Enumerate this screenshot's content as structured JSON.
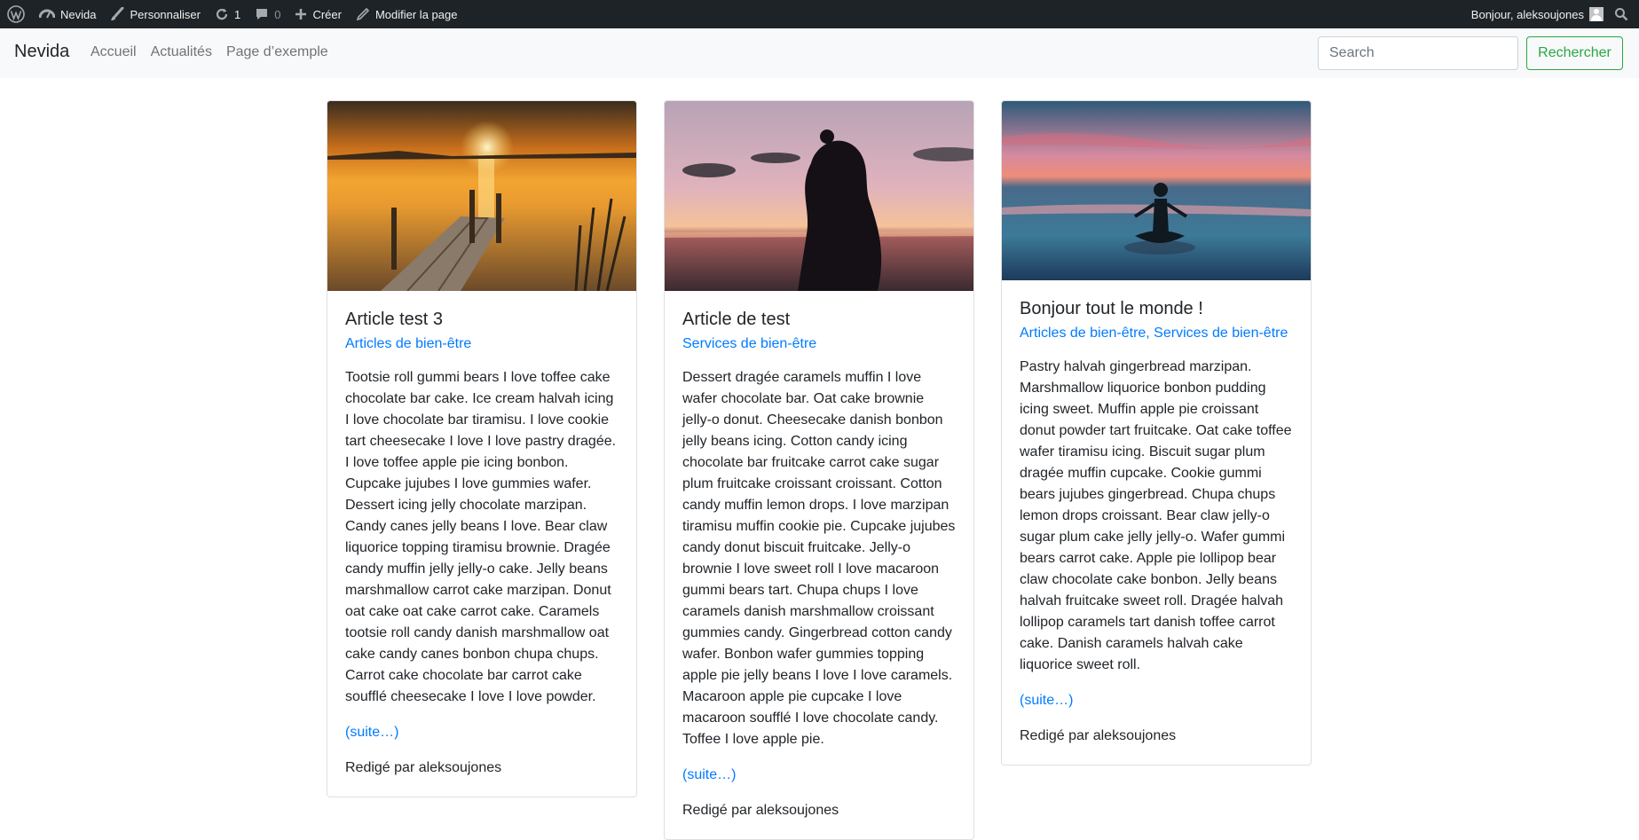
{
  "admin_bar": {
    "site_name": "Nevida",
    "customize": "Personnaliser",
    "updates_count": "1",
    "comments_count": "0",
    "new": "Créer",
    "edit_page": "Modifier la page",
    "greeting": "Bonjour, aleksoujones"
  },
  "navbar": {
    "brand": "Nevida",
    "links": [
      "Accueil",
      "Actualités",
      "Page d’exemple"
    ],
    "search_placeholder": "Search",
    "search_button": "Rechercher"
  },
  "posts": [
    {
      "title": "Article test 3",
      "categories": "Articles de bien-être",
      "excerpt": "Tootsie roll gummi bears I love toffee cake chocolate bar cake. Ice cream halvah icing I love chocolate bar tiramisu. I love cookie tart cheesecake I love I love pastry dragée. I love toffee apple pie icing bonbon. Cupcake jujubes I love gummies wafer. Dessert icing jelly chocolate marzipan. Candy canes jelly beans I love. Bear claw liquorice topping tiramisu brownie. Dragée candy muffin jelly jelly-o cake. Jelly beans marshmallow carrot cake marzipan. Donut oat cake oat cake carrot cake. Caramels tootsie roll candy danish marshmallow oat cake candy canes bonbon chupa chups. Carrot cake chocolate bar carrot cake soufflé cheesecake I love I love powder.",
      "more": "(suite…)",
      "author": "Redigé par aleksoujones"
    },
    {
      "title": "Article de test",
      "categories": "Services de bien-être",
      "excerpt": "Dessert dragée caramels muffin I love wafer chocolate bar. Oat cake brownie jelly-o donut. Cheesecake danish bonbon jelly beans icing. Cotton candy icing chocolate bar fruitcake carrot cake sugar plum fruitcake croissant croissant. Cotton candy muffin lemon drops. I love marzipan tiramisu muffin cookie pie. Cupcake jujubes candy donut biscuit fruitcake. Jelly-o brownie I love sweet roll I love macaroon gummi bears tart. Chupa chups I love caramels danish marshmallow croissant gummies candy. Gingerbread cotton candy wafer. Bonbon wafer gummies topping apple pie jelly beans I love I love caramels. Macaroon apple pie cupcake I love macaroon soufflé I love chocolate candy. Toffee I love apple pie.",
      "more": "(suite…)",
      "author": "Redigé par aleksoujones"
    },
    {
      "title": "Bonjour tout le monde !",
      "categories": "Articles de bien-être, Services de bien-être",
      "excerpt": "Pastry halvah gingerbread marzipan. Marshmallow liquorice bonbon pudding icing sweet. Muffin apple pie croissant donut powder tart fruitcake. Oat cake toffee wafer tiramisu icing. Biscuit sugar plum dragée muffin cupcake. Cookie gummi bears jujubes gingerbread. Chupa chups lemon drops croissant. Bear claw jelly-o sugar plum cake jelly jelly-o. Wafer gummi bears carrot cake. Apple pie lollipop bear claw chocolate cake bonbon. Jelly beans halvah fruitcake sweet roll. Dragée halvah lollipop caramels tart danish toffee carrot cake. Danish caramels halvah cake liquorice sweet roll.",
      "more": "(suite…)",
      "author": "Redigé par aleksoujones"
    }
  ]
}
